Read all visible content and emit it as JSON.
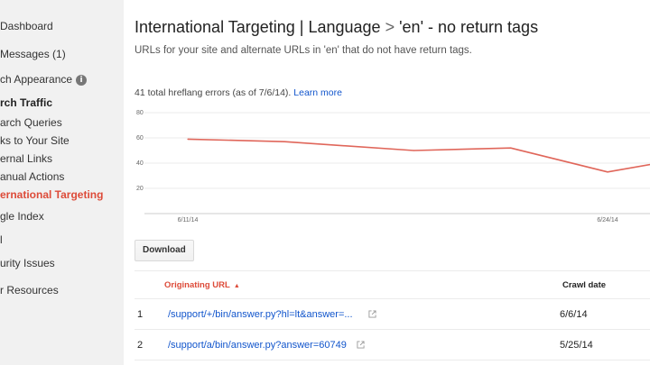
{
  "sidebar": {
    "items": [
      {
        "label": "Dashboard"
      },
      {
        "label": "Messages (1)"
      },
      {
        "label": "ch Appearance"
      },
      {
        "label": "rch Traffic"
      },
      {
        "label": "arch Queries"
      },
      {
        "label": "ks to Your Site"
      },
      {
        "label": "ernal Links"
      },
      {
        "label": "anual Actions"
      },
      {
        "label": "ernational Targeting"
      },
      {
        "label": "gle Index"
      },
      {
        "label": "l"
      },
      {
        "label": "urity Issues"
      },
      {
        "label": "r Resources"
      }
    ],
    "info_icon_glyph": "i"
  },
  "header": {
    "title_main": "International Targeting | Language",
    "title_sep": ">",
    "title_tail": "'en' - no return tags",
    "subtitle": "URLs for your site and alternate URLs in 'en' that do not have return tags."
  },
  "summary": {
    "text": "41 total hreflang errors (as of 7/6/14).",
    "link": "Learn more"
  },
  "chart_data": {
    "type": "line",
    "y_ticks": [
      "80",
      "60",
      "40",
      "20"
    ],
    "ylim": [
      0,
      80
    ],
    "x_tick_labels": [
      "6/11/14",
      "6/24/14"
    ],
    "series": [
      {
        "values": [
          {
            "date": "6/11/14",
            "y": 59
          },
          {
            "date": "6/14/14",
            "y": 57
          },
          {
            "date": "6/18/14",
            "y": 50
          },
          {
            "date": "6/21/14",
            "y": 52
          },
          {
            "date": "6/24/14",
            "y": 33
          },
          {
            "date": "6/26/14",
            "y": 42
          }
        ]
      }
    ],
    "grid": true,
    "line_color": "#e0665a"
  },
  "toolbar": {
    "download_label": "Download"
  },
  "table": {
    "col_url": "Originating URL",
    "col_date": "Crawl date",
    "sort_glyph": "▲",
    "rows": [
      {
        "num": "1",
        "url": "/support/+/bin/answer.py?hl=lt&answer=...",
        "date": "6/6/14"
      },
      {
        "num": "2",
        "url": "/support/a/bin/answer.py?answer=60749",
        "date": "5/25/14"
      }
    ]
  }
}
